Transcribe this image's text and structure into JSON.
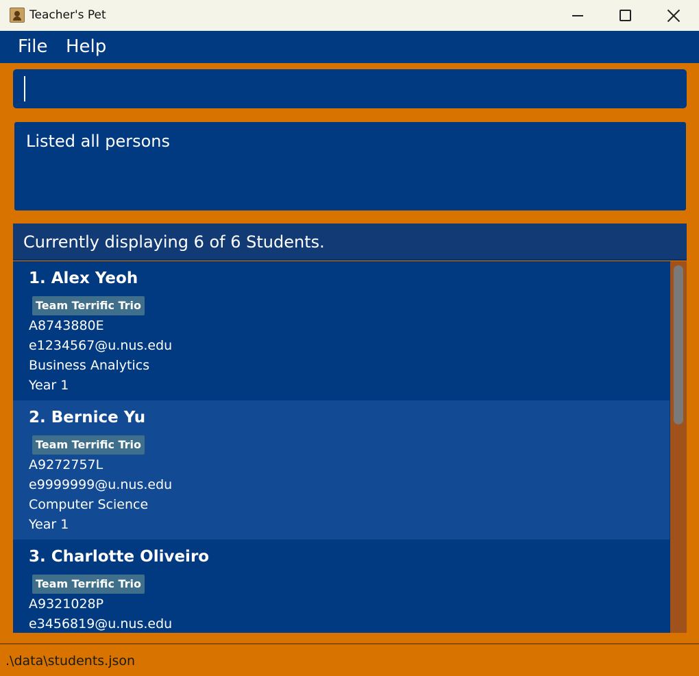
{
  "window": {
    "title": "Teacher's Pet"
  },
  "menu": {
    "file": "File",
    "help": "Help"
  },
  "command": {
    "value": ""
  },
  "result": {
    "text": "Listed all persons"
  },
  "list": {
    "header": "Currently displaying 6 of 6 Students.",
    "students": [
      {
        "name": "1. Alex Yeoh",
        "tag": "Team Terrific Trio",
        "id": "A8743880E",
        "email": "e1234567@u.nus.edu",
        "major": "Business Analytics",
        "year": "Year 1"
      },
      {
        "name": "2. Bernice Yu",
        "tag": "Team Terrific Trio",
        "id": "A9272757L",
        "email": "e9999999@u.nus.edu",
        "major": "Computer Science",
        "year": "Year 1"
      },
      {
        "name": "3. Charlotte Oliveiro",
        "tag": "Team Terrific Trio",
        "id": "A9321028P",
        "email": "e3456819@u.nus.edu",
        "major": "",
        "year": ""
      }
    ]
  },
  "status": {
    "path": ".\\data\\students.json"
  },
  "colors": {
    "accent": "#d87300",
    "panel": "#013a80",
    "card_alt": "#124a94",
    "tag": "#3f6f8a"
  }
}
